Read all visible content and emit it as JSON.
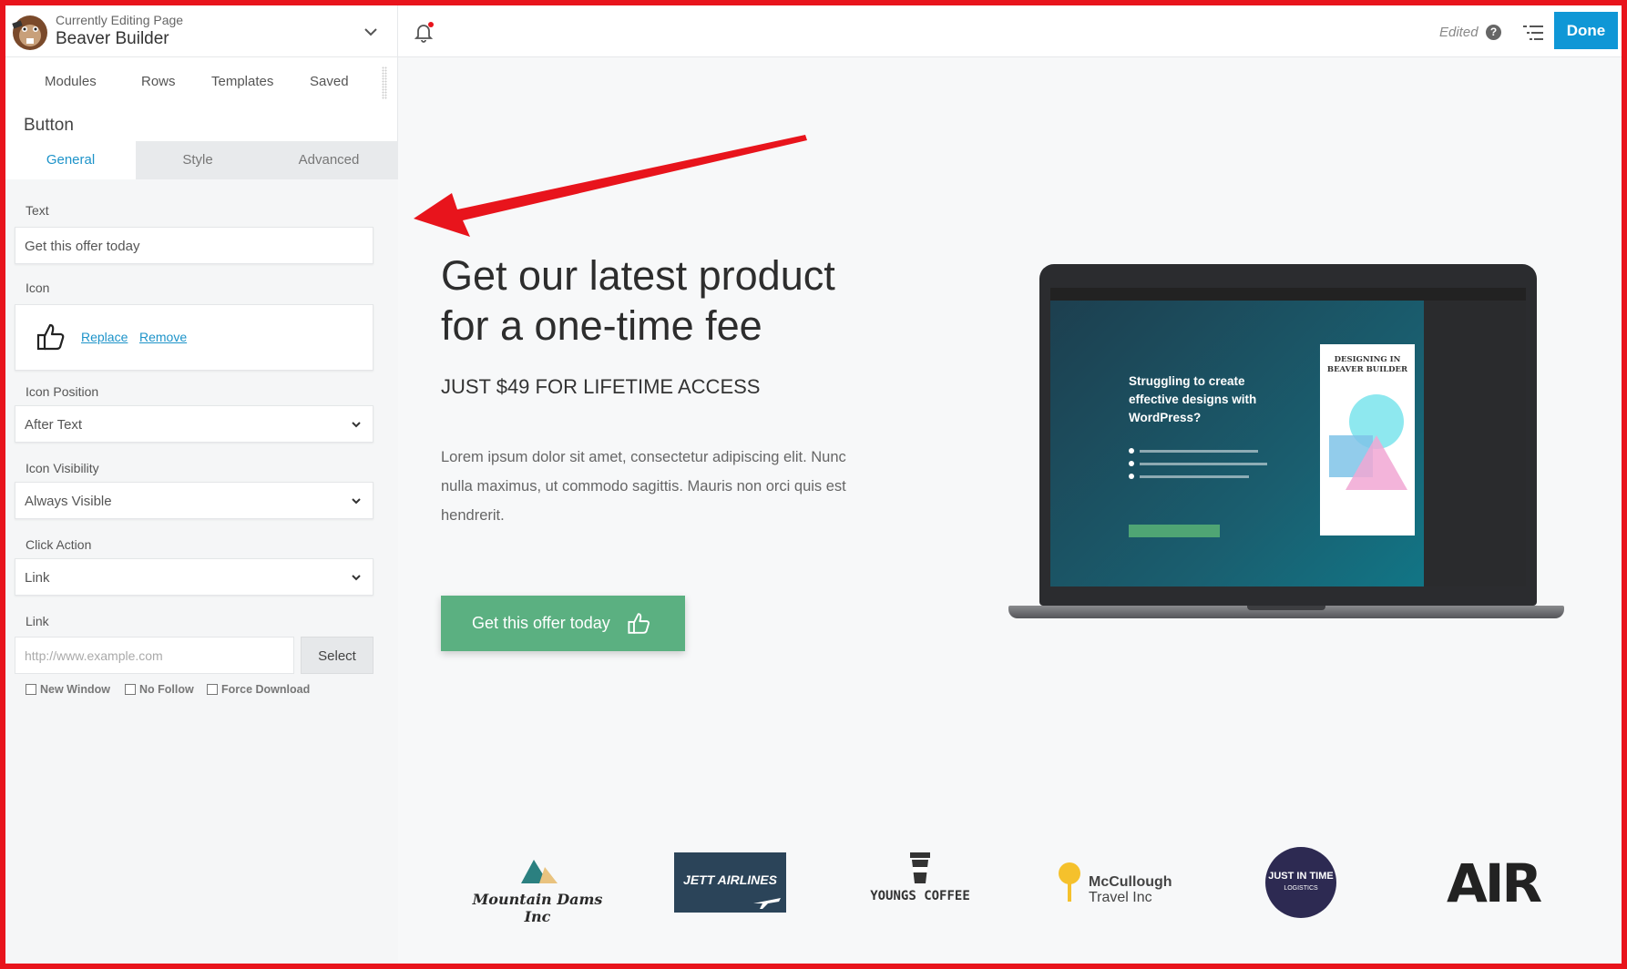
{
  "topbar": {
    "currently_editing_label": "Currently Editing Page",
    "page_name": "Beaver Builder",
    "status": "Edited",
    "done_label": "Done",
    "accent_color": "#0f97d6"
  },
  "sidebar": {
    "tabs": [
      "Modules",
      "Rows",
      "Templates",
      "Saved"
    ],
    "panel_title": "Button",
    "subtabs": [
      "General",
      "Style",
      "Advanced"
    ],
    "active_subtab": "General",
    "fields": {
      "text_label": "Text",
      "text_value": "Get this offer today",
      "icon_label": "Icon",
      "icon_replace": "Replace",
      "icon_remove": "Remove",
      "icon_position_label": "Icon Position",
      "icon_position_value": "After Text",
      "icon_visibility_label": "Icon Visibility",
      "icon_visibility_value": "Always Visible",
      "click_action_label": "Click Action",
      "click_action_value": "Link",
      "link_label": "Link",
      "link_placeholder": "http://www.example.com",
      "select_label": "Select",
      "checkboxes": [
        "New Window",
        "No Follow",
        "Force Download"
      ]
    }
  },
  "hero": {
    "title_line1": "Get our latest product",
    "title_line2": "for a one-time fee",
    "subtitle": "JUST $49 FOR LIFETIME ACCESS",
    "body": "Lorem ipsum dolor sit amet, consectetur adipiscing elit. Nunc nulla maximus, ut commodo sagittis. Mauris non orci quis est hendrerit.",
    "cta_label": "Get this offer today",
    "cta_color": "#5bb081"
  },
  "laptop_screen": {
    "heading": "Struggling to create effective designs with WordPress?",
    "book_title_line1": "DESIGNING IN",
    "book_title_line2": "BEAVER BUILDER"
  },
  "logos": {
    "mountain": "Mountain Dams Inc",
    "jett": "JETT AIRLINES",
    "youngs": "YOUNGS COFFEE",
    "mccullough_line1": "McCullough",
    "mccullough_line2": "Travel Inc",
    "jit_line1": "JUST IN TIME",
    "jit_line2": "LOGISTICS",
    "air": "AIR"
  },
  "annotation_color": "#e8141c"
}
